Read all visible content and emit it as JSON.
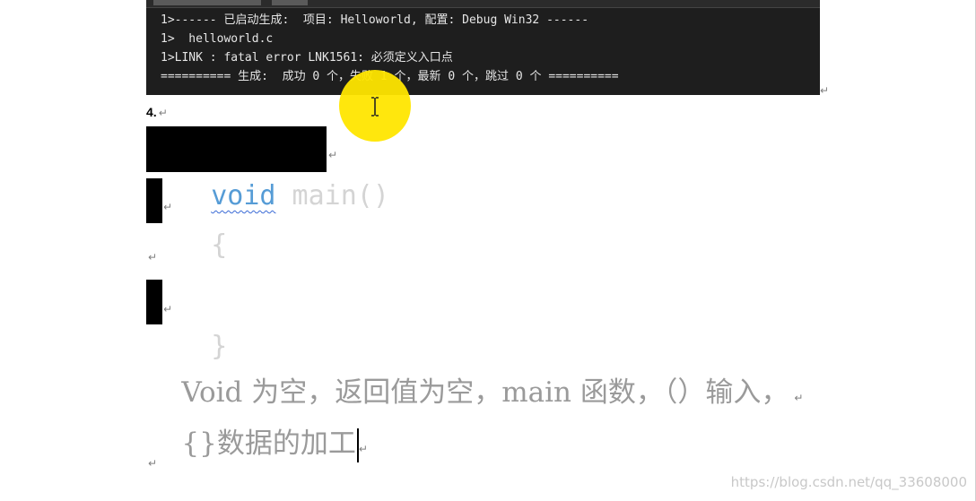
{
  "console": {
    "lines": [
      "1>------ 已启动生成:  项目: Helloworld, 配置: Debug Win32 ------",
      "1>  helloworld.c",
      "1>LINK : fatal error LNK1561: 必须定义入口点",
      "========== 生成:  成功 0 个，失败 1 个，最新 0 个，跳过 0 个 =========="
    ]
  },
  "doc": {
    "heading": "4.",
    "code_keyword": "void",
    "code_rest": " main()",
    "brace_open": "{",
    "brace_close": "}",
    "note_line1": "Void 为空，返回值为空，main 函数，（）输入，",
    "note_line2": "{}数据的加工",
    "paragraph_mark": "↵"
  },
  "watermark": "https://blog.csdn.net/qq_33608000",
  "colors": {
    "console_bg": "#1e1e1e",
    "code_bg": "#000000",
    "keyword": "#569cd6",
    "note_text": "#9a9a9a",
    "cursor_highlight": "#ffe600"
  }
}
